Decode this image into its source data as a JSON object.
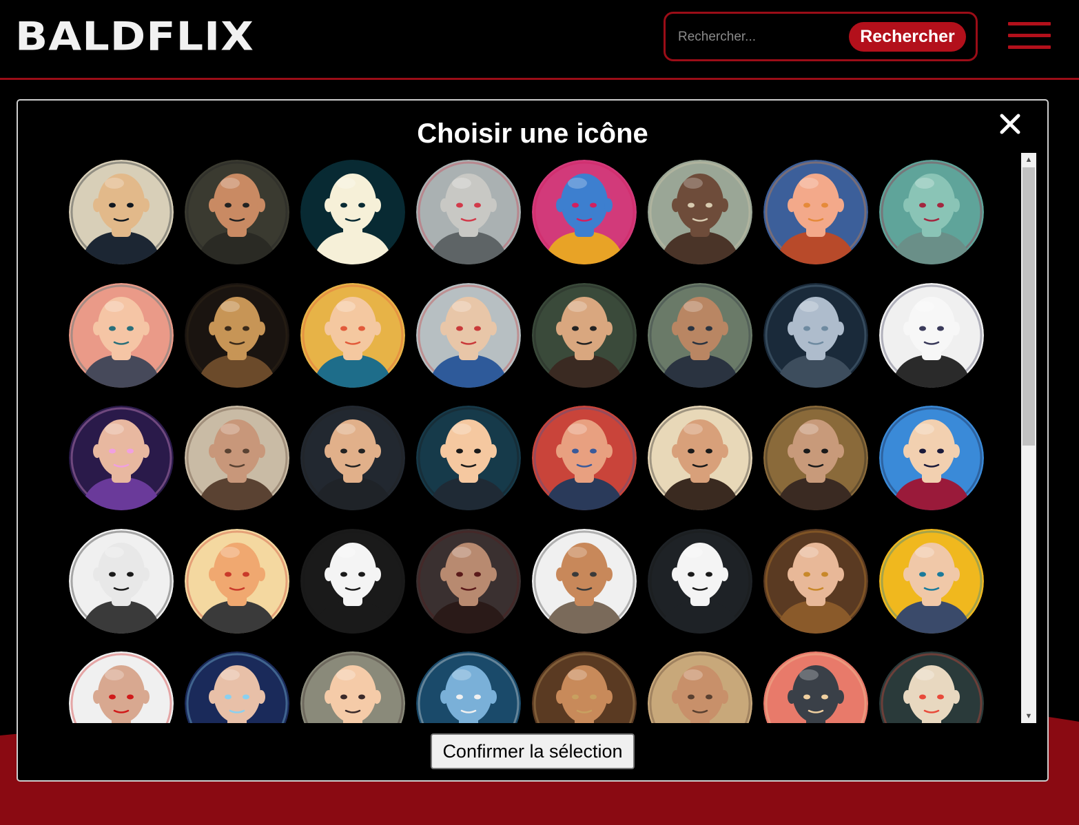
{
  "header": {
    "logo": "BALDFLIX",
    "search_placeholder": "Rechercher...",
    "search_button": "Rechercher"
  },
  "modal": {
    "title": "Choisir une icône",
    "close_symbol": "✕",
    "confirm_button": "Confirmer la sélection",
    "scroll_up": "▲",
    "scroll_down": "▼"
  },
  "colors": {
    "accent": "#b3101b",
    "header_line": "#9b0d17",
    "background": "#000000"
  },
  "avatars": [
    {
      "name": "ninja-headband",
      "bg": "#d8cfb8",
      "skin": "#e2b98a",
      "cloth": "#1c2633",
      "accent": "#111820"
    },
    {
      "name": "glasses-realistic",
      "bg": "#3a3a30",
      "skin": "#c98a63",
      "cloth": "#2a2a24",
      "accent": "#222"
    },
    {
      "name": "minimal-white-head",
      "bg": "#082a33",
      "skin": "#f6f0d8",
      "cloth": "#f6f0d8",
      "accent": "#082a33"
    },
    {
      "name": "cyborg",
      "bg": "#aab1b2",
      "skin": "#c8c8c4",
      "cloth": "#5e6466",
      "accent": "#d23a4a"
    },
    {
      "name": "pop-art-warrior",
      "bg": "#d23a7a",
      "skin": "#3d7fcf",
      "cloth": "#e8a326",
      "accent": "#d21f5f"
    },
    {
      "name": "dark-stripe-face",
      "bg": "#9aa696",
      "skin": "#6e4c3a",
      "cloth": "#4a3428",
      "accent": "#d8cbb0"
    },
    {
      "name": "cartoon-kid",
      "bg": "#3c5f9a",
      "skin": "#f3a98a",
      "cloth": "#b84a2a",
      "accent": "#e58a3a"
    },
    {
      "name": "bearded-elder",
      "bg": "#5fa49a",
      "skin": "#8ac4b6",
      "cloth": "#6a8f88",
      "accent": "#a3263f"
    },
    {
      "name": "glasses-cartoon-pink",
      "bg": "#ea9a88",
      "skin": "#f5c5a5",
      "cloth": "#46495a",
      "accent": "#2a6f7a"
    },
    {
      "name": "golden-baroque",
      "bg": "#1a1410",
      "skin": "#c79556",
      "cloth": "#6b4a2a",
      "accent": "#3a2a1a"
    },
    {
      "name": "retro-graphic",
      "bg": "#e7b347",
      "skin": "#f4c8a0",
      "cloth": "#1e6d8a",
      "accent": "#e25a3a"
    },
    {
      "name": "anime-hero",
      "bg": "#b7bfc2",
      "skin": "#e8c6a8",
      "cloth": "#2e5a9a",
      "accent": "#c93a3a"
    },
    {
      "name": "glasses-3d",
      "bg": "#3a4a3a",
      "skin": "#d9a77f",
      "cloth": "#3a2a22",
      "accent": "#222"
    },
    {
      "name": "realistic-man",
      "bg": "#6a7a68",
      "skin": "#b98663",
      "cloth": "#2a3340",
      "accent": "#2a3340"
    },
    {
      "name": "silver-android",
      "bg": "#1a2a3a",
      "skin": "#aebccc",
      "cloth": "#3d4d5d",
      "accent": "#6e8aa0"
    },
    {
      "name": "manga-sketch",
      "bg": "#f0f0f0",
      "skin": "#f7f7f7",
      "cloth": "#2a2a2a",
      "accent": "#3a3a5a"
    },
    {
      "name": "cosmic-woman",
      "bg": "#2a1a4a",
      "skin": "#e8b8a0",
      "cloth": "#6a3a9a",
      "accent": "#f0a0e0"
    },
    {
      "name": "bearded-realistic",
      "bg": "#c9bba5",
      "skin": "#c8977a",
      "cloth": "#5a4232",
      "accent": "#5a4232"
    },
    {
      "name": "glasses-friendly",
      "bg": "#222830",
      "skin": "#e1b08a",
      "cloth": "#1f2328",
      "accent": "#222"
    },
    {
      "name": "round-glasses-kid",
      "bg": "#163a4a",
      "skin": "#f5c8a0",
      "cloth": "#1f2a35",
      "accent": "#1a1a1a"
    },
    {
      "name": "headband-old-man",
      "bg": "#c9443a",
      "skin": "#e8a080",
      "cloth": "#2a3a5a",
      "accent": "#3a5a9a"
    },
    {
      "name": "comic-bearded",
      "bg": "#e8d8b8",
      "skin": "#d8a07a",
      "cloth": "#3a2a20",
      "accent": "#1a1a1a"
    },
    {
      "name": "masked-gold-frame",
      "bg": "#8a6a3a",
      "skin": "#c89a7a",
      "cloth": "#3a2a22",
      "accent": "#1a1a1a"
    },
    {
      "name": "anime-stripes",
      "bg": "#3a8ad8",
      "skin": "#f2d0b0",
      "cloth": "#9a1a3a",
      "accent": "#1a1a3a"
    },
    {
      "name": "alien-grey",
      "bg": "#f0f0f0",
      "skin": "#e8e8e8",
      "cloth": "#3a3a3a",
      "accent": "#1a1a1a"
    },
    {
      "name": "cartoon-scar",
      "bg": "#f4d8a0",
      "skin": "#f0a870",
      "cloth": "#3a3a3a",
      "accent": "#c93a2a"
    },
    {
      "name": "sunglasses-mono",
      "bg": "#1a1a1a",
      "skin": "#f4f4f4",
      "cloth": "#1a1a1a",
      "accent": "#1a1a1a"
    },
    {
      "name": "stern-realistic",
      "bg": "#3a3030",
      "skin": "#b88a70",
      "cloth": "#2a1a18",
      "accent": "#5a1a1a"
    },
    {
      "name": "angry-comic",
      "bg": "#f0f0f0",
      "skin": "#c8885a",
      "cloth": "#7a6a5a",
      "accent": "#3a3a3a"
    },
    {
      "name": "masked-mono",
      "bg": "#1e2226",
      "skin": "#f4f4f4",
      "cloth": "#1e2226",
      "accent": "#1a1a1a"
    },
    {
      "name": "steampunk-woman",
      "bg": "#5a3a22",
      "skin": "#e8b898",
      "cloth": "#8a5a2a",
      "accent": "#c8882a"
    },
    {
      "name": "golden-halo",
      "bg": "#f0b81e",
      "skin": "#f0c8a8",
      "cloth": "#3a4a6a",
      "accent": "#1a7a9a"
    },
    {
      "name": "red-eyes",
      "bg": "#f0f0f0",
      "skin": "#d8a890",
      "cloth": "#3a2a2a",
      "accent": "#d01a1a"
    },
    {
      "name": "space-woman",
      "bg": "#1a2a5a",
      "skin": "#e8c0a8",
      "cloth": "#3a4a8a",
      "accent": "#8ad0f0"
    },
    {
      "name": "anime-child",
      "bg": "#8a8a7a",
      "skin": "#f5cba8",
      "cloth": "#6a6a5a",
      "accent": "#3a2a2a"
    },
    {
      "name": "blue-android",
      "bg": "#1a4a6a",
      "skin": "#7ab0d8",
      "cloth": "#2a5a7a",
      "accent": "#f0f0f0"
    },
    {
      "name": "steampunk-goggles",
      "bg": "#5a3a22",
      "skin": "#c88a5a",
      "cloth": "#6a4a2a",
      "accent": "#c8a060"
    },
    {
      "name": "realistic-smile",
      "bg": "#c8a87a",
      "skin": "#c8906a",
      "cloth": "#5a4030",
      "accent": "#5a4030"
    },
    {
      "name": "pop-dark-face",
      "bg": "#e87a6a",
      "skin": "#3a4048",
      "cloth": "#6ab0d8",
      "accent": "#f0d0a0"
    },
    {
      "name": "circles-dark-face",
      "bg": "#2a3a3a",
      "skin": "#e8d8c0",
      "cloth": "#1a1a1a",
      "accent": "#e84a3a"
    }
  ]
}
